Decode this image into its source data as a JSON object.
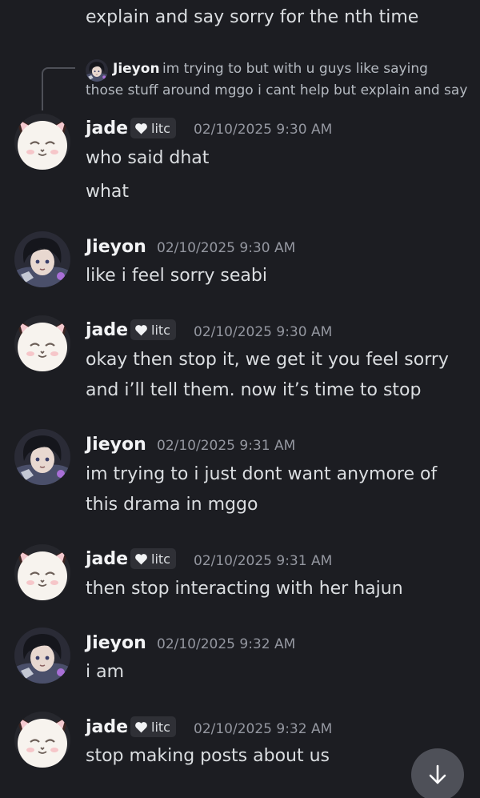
{
  "top_text": "explain and say sorry for the nth time",
  "reply": {
    "author": "Jieyon",
    "line1": "im trying to but with u guys like saying",
    "line2": "those stuff around mggo i cant help but explain and say"
  },
  "messages": [
    {
      "author": "jade",
      "tag": "litc",
      "timestamp": "02/10/2025 9:30 AM",
      "lines": [
        "who said dhat",
        "what"
      ]
    },
    {
      "author": "Jieyon",
      "timestamp": "02/10/2025 9:30 AM",
      "lines": [
        "like i feel sorry seabi"
      ]
    },
    {
      "author": "jade",
      "tag": "litc",
      "timestamp": "02/10/2025 9:30 AM",
      "lines": [
        "okay then stop it, we get it you feel sorry",
        "and i’ll tell them. now it’s time to stop"
      ]
    },
    {
      "author": "Jieyon",
      "timestamp": "02/10/2025 9:31 AM",
      "lines": [
        "im trying to i just dont want anymore of",
        "this drama in mggo"
      ]
    },
    {
      "author": "jade",
      "tag": "litc",
      "timestamp": "02/10/2025 9:31 AM",
      "lines": [
        "then stop interacting with her hajun"
      ]
    },
    {
      "author": "Jieyon",
      "timestamp": "02/10/2025 9:32 AM",
      "lines": [
        "i am"
      ]
    },
    {
      "author": "jade",
      "tag": "litc",
      "timestamp": "02/10/2025 9:32 AM",
      "lines": [
        "stop making posts about us"
      ]
    }
  ],
  "icons": {
    "cat_avatar": "white-cat-avatar",
    "person_avatar": "dark-haired-character-avatar",
    "tag_icon": "heart-icon",
    "scroll": "arrow-down-icon"
  },
  "colors": {
    "background": "#1c1d22",
    "tag_background": "#2f3036",
    "timestamp": "#9497a0",
    "scroll_button": "#4e5058"
  }
}
